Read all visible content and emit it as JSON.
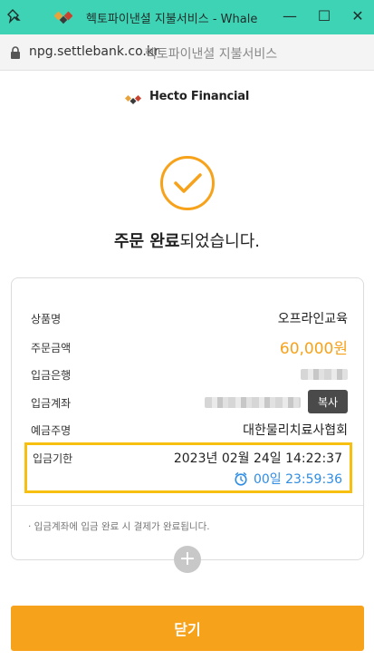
{
  "window": {
    "title": "헥토파이낸셜 지불서비스 - Whale",
    "accent": "#3fd3b5"
  },
  "address": {
    "domain": "npg.settlebank.co.kr",
    "page_title": "헥토파이낸셜 지불서비스"
  },
  "brand": {
    "name": "Hecto Financial"
  },
  "status": {
    "strong": "주문 완료",
    "rest": "되었습니다."
  },
  "order": {
    "product_label": "상품명",
    "product_value": "오프라인교육",
    "amount_label": "주문금액",
    "amount_value": "60,000원",
    "bank_label": "입금은행",
    "account_label": "입금계좌",
    "copy_label": "복사",
    "holder_label": "예금주명",
    "holder_value": "대한물리치료사협회",
    "deadline_label": "입금기한",
    "deadline_value": "2023년 02월 24일 14:22:37",
    "remaining_value": "00일 23:59:36"
  },
  "note": "· 입금계좌에 입금 완료 시 결제가 완료됩니다.",
  "close_label": "닫기",
  "colors": {
    "primary": "#f7a21b",
    "highlight_border": "#f7c010",
    "timer": "#2f8de4"
  },
  "icons": [
    "pin-icon",
    "logo-icon",
    "lock-icon",
    "check-circle-icon",
    "clock-icon",
    "plus-icon"
  ]
}
